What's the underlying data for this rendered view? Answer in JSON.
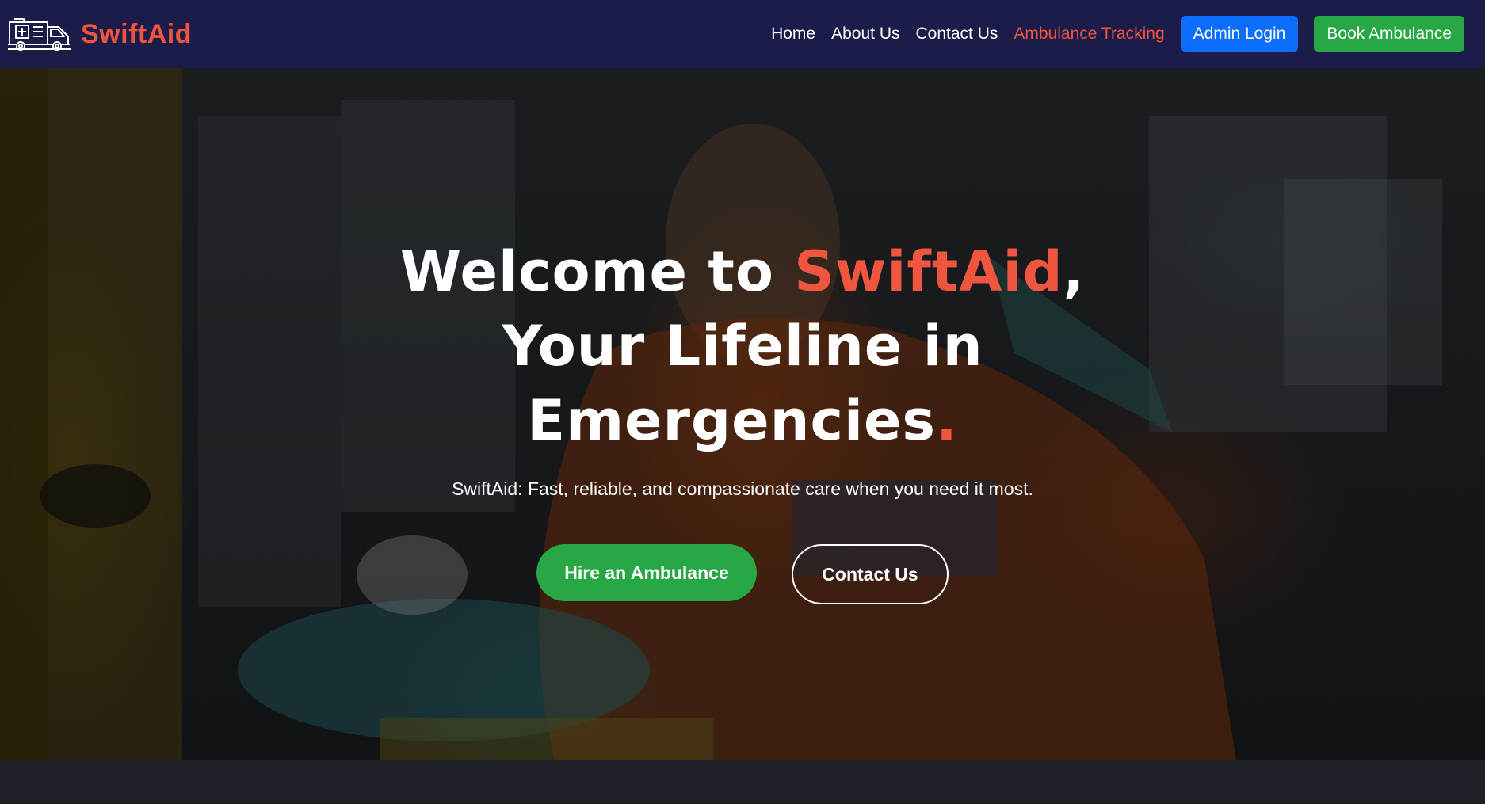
{
  "navbar": {
    "brand_name": "SwiftAid",
    "logo_icon": "ambulance-icon",
    "links": [
      {
        "label": "Home"
      },
      {
        "label": "About Us"
      },
      {
        "label": "Contact Us"
      },
      {
        "label": "Ambulance Tracking"
      }
    ],
    "admin_button": "Admin Login",
    "book_button": "Book Ambulance"
  },
  "hero": {
    "title_part1": "Welcome to ",
    "title_accent": "SwiftAid",
    "title_part2": ",",
    "title_line2": "Your Lifeline in",
    "title_line3": "Emergencies",
    "title_dot": ".",
    "subtitle": "SwiftAid: Fast, reliable, and compassionate care when you need it most.",
    "hire_button": "Hire an Ambulance",
    "contact_button": "Contact Us"
  },
  "colors": {
    "nav_bg": "#1c1c4a",
    "accent": "#f0553f",
    "primary": "#0d6efd",
    "success": "#28a745"
  }
}
